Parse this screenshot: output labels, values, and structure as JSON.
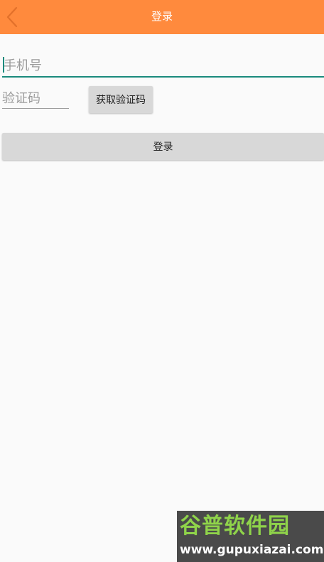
{
  "header": {
    "title": "登录",
    "back_icon": "chevron-left-icon",
    "background_color": "#ff8a3d"
  },
  "form": {
    "phone_placeholder": "手机号",
    "phone_value": "",
    "code_placeholder": "验证码",
    "code_value": "",
    "get_code_label": "获取验证码",
    "login_label": "登录",
    "accent_color": "#1a8a7c"
  },
  "watermark": {
    "site_name": "谷普软件园",
    "url": "www.gupuxiazai.com"
  }
}
